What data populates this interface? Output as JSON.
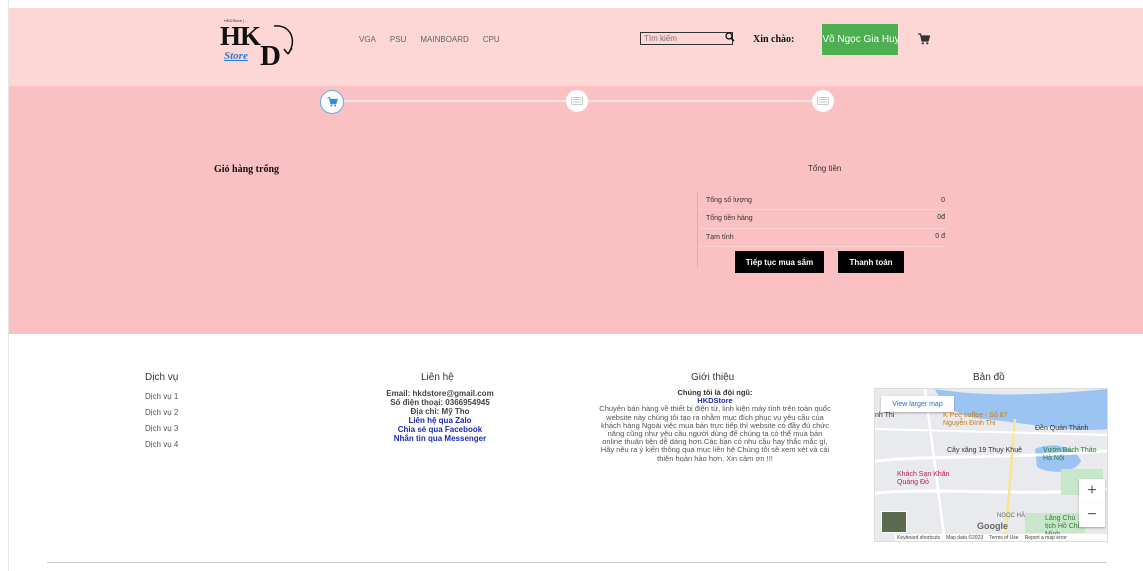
{
  "header": {
    "logo": {
      "tiny": "HKDStore | ...",
      "hk": "HK",
      "d": "D",
      "store": "Store"
    },
    "nav": [
      "VGA",
      "PSU",
      "MAINBOARD",
      "CPU"
    ],
    "search_placeholder": "Tìm kiếm",
    "greeting": "Xin chào:",
    "user_name": "Võ Ngọc Gia Huy"
  },
  "cart": {
    "empty_message": "Giỏ hàng trống",
    "total_title": "Tổng tiền",
    "rows": [
      {
        "label": "Tổng số lượng",
        "value": "0"
      },
      {
        "label": "Tổng tiền hàng",
        "value": "0đ"
      },
      {
        "label": "Tạm tính",
        "value": "0 đ"
      }
    ],
    "continue_label": "Tiếp tục mua sắm",
    "checkout_label": "Thanh toán"
  },
  "footer": {
    "services": {
      "title": "Dịch vụ",
      "items": [
        "Dịch vụ 1",
        "Dịch vụ 2",
        "Dịch vụ 3",
        "Dịch vụ 4"
      ]
    },
    "contact": {
      "title": "Liên hệ",
      "email": "Email: hkdstore@gmail.com",
      "phone": "Số điện thoại: 0366954945",
      "address": "Địa chỉ: Mỹ Tho",
      "zalo": "Liên hệ qua Zalo",
      "facebook": "Chia sẻ qua Facebook",
      "messenger": "Nhắn tin qua Messenger"
    },
    "intro": {
      "title": "Giới thiệu",
      "team": "Chúng tôi là đội ngũ:",
      "brand": "HKDStore",
      "text": "Chuyên bán hàng về thiết bị điện tử, linh kiện máy tính trên toàn quốc website này chúng tôi tạo ra nhằm mục đích phục vụ yêu cầu của khách hàng Ngoài việc mua bán trực tiếp thì website có đầy đủ chức năng cũng như yêu cầu người dùng để chúng ta có thể mua bán online thuận tiện dễ dàng hơn.Các bạn có nhu cầu hay thắc mắc gì, Hãy nêu ra ý kiến thông qua mục liên hệ Chúng tôi sẽ xem xét và cải thiện hoàn hảo hơn. Xin cảm ơn !!!"
    },
    "map": {
      "title": "Bản đồ",
      "view_larger": "View larger map",
      "labels": [
        "K Pee coffee - Số 87 Nguyễn Đình Thi",
        "Đền Quán Thánh",
        "Cây xăng 19 Thụy Khuê",
        "Vườn Bách Thảo Hà Nội",
        "Khách Sạn Khăn Quàng Đỏ",
        "NGỌC HÀ",
        "Lăng Chủ tịch Hồ Chí Minh",
        "nh Thi"
      ],
      "zoom_in": "+",
      "zoom_out": "−",
      "google": "Google",
      "attribution": [
        "Keyboard shortcuts",
        "Map data ©2023",
        "Terms of Use",
        "Report a map error"
      ]
    }
  },
  "colors": {
    "header_bg": "#fdd6d6",
    "main_bg": "#fbc0c1",
    "user_btn": "#4caf50",
    "link": "#1a2bb8"
  }
}
